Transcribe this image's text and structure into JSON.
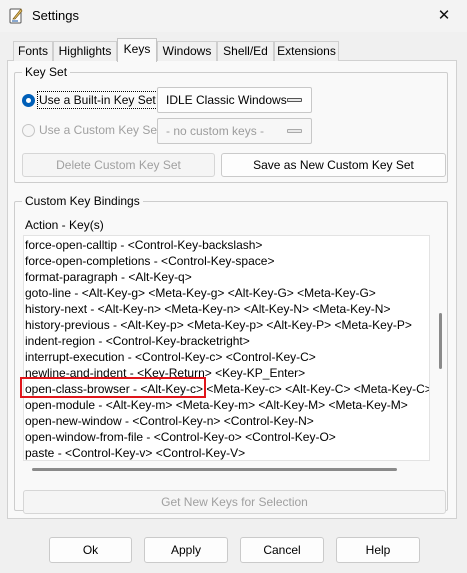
{
  "window": {
    "title": "Settings",
    "close_glyph": "✕",
    "app_icon": "idle-feather-icon"
  },
  "tabs": [
    {
      "label": "Fonts"
    },
    {
      "label": "Highlights"
    },
    {
      "label": "Keys",
      "active": true
    },
    {
      "label": "Windows"
    },
    {
      "label": "Shell/Ed"
    },
    {
      "label": "Extensions"
    }
  ],
  "key_set": {
    "title": "Key Set",
    "builtin_label": "Use a Built-in Key Set",
    "builtin_value": "IDLE Classic Windows",
    "builtin_selected": true,
    "custom_label": "Use a Custom Key Set",
    "custom_value": "- no custom keys -",
    "delete_label": "Delete Custom Key Set",
    "save_label": "Save as New Custom Key Set"
  },
  "bindings": {
    "title": "Custom Key Bindings",
    "header": "Action - Key(s)",
    "rows": [
      "force-open-calltip - <Control-Key-backslash>",
      "force-open-completions - <Control-Key-space>",
      "format-paragraph - <Alt-Key-q>",
      "goto-line - <Alt-Key-g> <Meta-Key-g> <Alt-Key-G> <Meta-Key-G>",
      "history-next - <Alt-Key-n> <Meta-Key-n> <Alt-Key-N> <Meta-Key-N>",
      "history-previous - <Alt-Key-p> <Meta-Key-p> <Alt-Key-P> <Meta-Key-P>",
      "indent-region - <Control-Key-bracketright>",
      "interrupt-execution - <Control-Key-c> <Control-Key-C>",
      "newline-and-indent - <Key-Return> <Key-KP_Enter>",
      "open-class-browser - <Alt-Key-c> <Meta-Key-c> <Alt-Key-C> <Meta-Key-C>",
      "open-module - <Alt-Key-m> <Meta-Key-m> <Alt-Key-M> <Meta-Key-M>",
      "open-new-window - <Control-Key-n> <Control-Key-N>",
      "open-window-from-file - <Control-Key-o> <Control-Key-O>",
      "paste - <Control-Key-v> <Control-Key-V>"
    ],
    "get_keys_label": "Get New Keys for Selection"
  },
  "actions": {
    "ok": "Ok",
    "apply": "Apply",
    "cancel": "Cancel",
    "help": "Help"
  },
  "colors": {
    "highlight_box": "#e0151b",
    "radio_accent": "#005fb8"
  }
}
